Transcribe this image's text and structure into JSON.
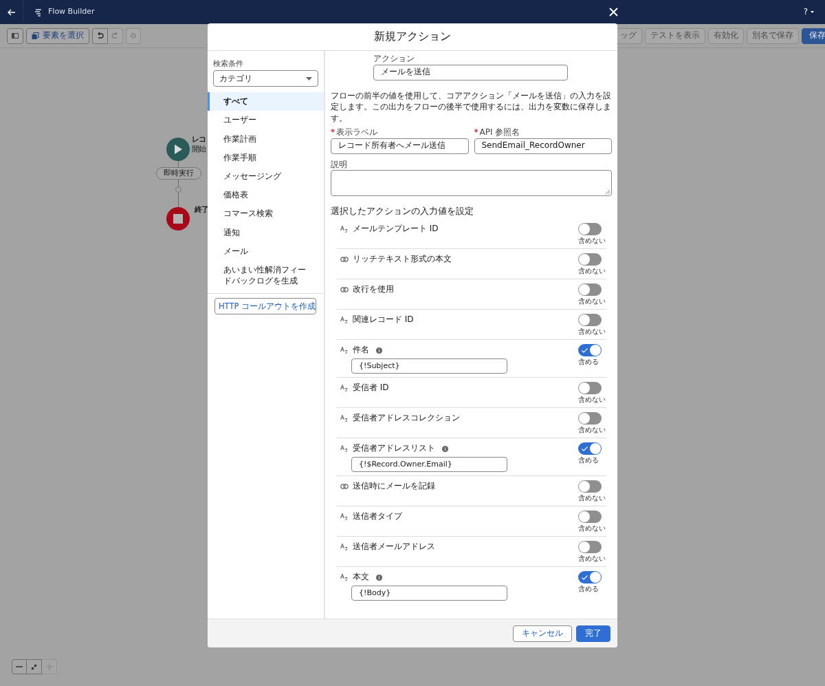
{
  "app": {
    "title": "Flow Builder",
    "help": "?"
  },
  "toolbar": {
    "select_button": "要素を選択",
    "undo_enabled": true,
    "redo_enabled": false,
    "right_buttons": [
      {
        "label": "ッグ",
        "kind": "plain"
      },
      {
        "label": "テストを表示",
        "kind": "plain"
      },
      {
        "label": "有効化",
        "kind": "plain"
      },
      {
        "label": "別名で保存",
        "kind": "plain"
      },
      {
        "label": "保存",
        "kind": "primary"
      }
    ]
  },
  "canvas": {
    "start": {
      "title": "レコ",
      "subtitle": "開始"
    },
    "connector": "即時実行",
    "end": {
      "title": "終了"
    }
  },
  "modal": {
    "title": "新規アクション",
    "filter": {
      "label": "検索条件",
      "value": "カテゴリ"
    },
    "categories": [
      {
        "label": "すべて",
        "selected": true
      },
      {
        "label": "ユーザー",
        "selected": false
      },
      {
        "label": "作業計画",
        "selected": false
      },
      {
        "label": "作業手順",
        "selected": false
      },
      {
        "label": "メッセージング",
        "selected": false
      },
      {
        "label": "価格表",
        "selected": false
      },
      {
        "label": "コマース検索",
        "selected": false
      },
      {
        "label": "通知",
        "selected": false
      },
      {
        "label": "メール",
        "selected": false
      },
      {
        "label": "あいまい性解消フィードバックログを生成",
        "selected": false
      }
    ],
    "create_button": "HTTP コールアウトを作成",
    "action": {
      "label": "アクション",
      "value": "メールを送信"
    },
    "description": "フローの前半の値を使用して、コアアクション「メールを送信」の入力を設定します。この出力をフローの後半で使用するには、出力を変数に保存します。",
    "fields": [
      {
        "label": "表示ラベル",
        "required_mark": "*",
        "value": "レコード所有者へメール送信"
      },
      {
        "label": "API 参照名",
        "required_mark": "*",
        "value": "SendEmail_RecordOwner"
      }
    ],
    "notes": {
      "label": "説明"
    },
    "section_title": "選択したアクションの入力値を設定",
    "parameters": [
      {
        "kind": "text",
        "label": "メールテンプレート ID",
        "info": false,
        "on": false,
        "status": "含めない"
      },
      {
        "kind": "boolean",
        "label": "リッチテキスト形式の本文",
        "info": false,
        "on": false,
        "status": "含めない"
      },
      {
        "kind": "boolean",
        "label": "改行を使用",
        "info": false,
        "on": false,
        "status": "含めない"
      },
      {
        "kind": "text",
        "label": "関連レコード ID",
        "info": false,
        "on": false,
        "status": "含めない"
      },
      {
        "kind": "text",
        "label": "件名",
        "info": true,
        "on": true,
        "value": "{!Subject}",
        "status": "含める"
      },
      {
        "kind": "text",
        "label": "受信者 ID",
        "info": false,
        "on": false,
        "status": "含めない"
      },
      {
        "kind": "text",
        "label": "受信者アドレスコレクション",
        "info": false,
        "on": false,
        "status": "含めない"
      },
      {
        "kind": "text",
        "label": "受信者アドレスリスト",
        "info": true,
        "on": true,
        "value": "{!$Record.Owner.Email}",
        "status": "含める"
      },
      {
        "kind": "boolean",
        "label": "送信時にメールを記録",
        "info": false,
        "on": false,
        "status": "含めない"
      },
      {
        "kind": "text",
        "label": "送信者タイプ",
        "info": false,
        "on": false,
        "status": "含めない"
      },
      {
        "kind": "text",
        "label": "送信者メールアドレス",
        "info": false,
        "on": false,
        "status": "含めない"
      },
      {
        "kind": "text",
        "label": "本文",
        "info": true,
        "on": true,
        "value": "{!Body}",
        "status": "含める"
      }
    ],
    "footer": {
      "cancel": "キャンセル",
      "done": "完了"
    }
  },
  "zoom": {
    "out_enabled": true,
    "in_enabled": false
  }
}
